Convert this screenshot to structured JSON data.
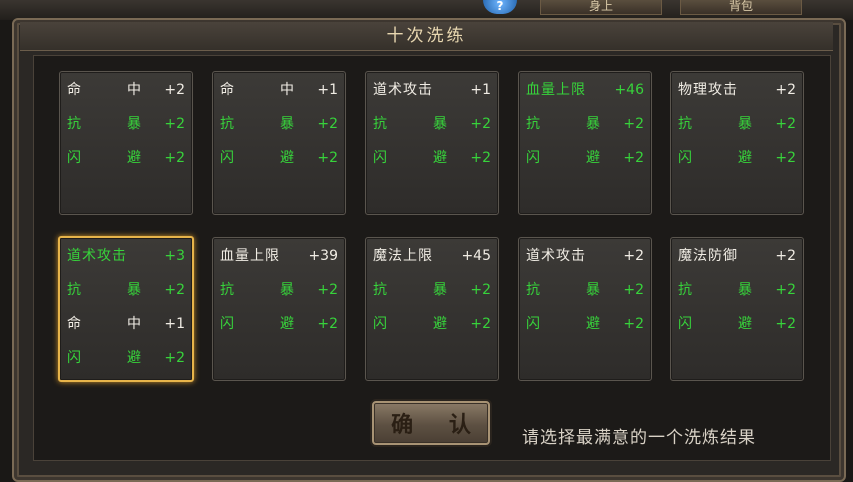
{
  "background": {
    "tabs": [
      "身上",
      "背包"
    ],
    "help_icon": "question-mark-icon"
  },
  "dialog": {
    "title": "十次洗练",
    "confirm_label": "确 认",
    "hint": "请选择最满意的一个洗炼结果",
    "accent_colors": {
      "green": "#37d33b",
      "white": "#f0ece4",
      "selected_border": "#e7b44a"
    }
  },
  "cards": [
    {
      "rows": [
        {
          "c1": "命",
          "c2": "中",
          "val": "+2",
          "color": "white"
        },
        {
          "c1": "抗",
          "c2": "暴",
          "val": "+2",
          "color": "green"
        },
        {
          "c1": "闪",
          "c2": "避",
          "val": "+2",
          "color": "green"
        }
      ]
    },
    {
      "rows": [
        {
          "c1": "命",
          "c2": "中",
          "val": "+1",
          "color": "white"
        },
        {
          "c1": "抗",
          "c2": "暴",
          "val": "+2",
          "color": "green"
        },
        {
          "c1": "闪",
          "c2": "避",
          "val": "+2",
          "color": "green"
        }
      ]
    },
    {
      "rows": [
        {
          "name": "道术攻击",
          "val": "+1",
          "color": "white"
        },
        {
          "c1": "抗",
          "c2": "暴",
          "val": "+2",
          "color": "green"
        },
        {
          "c1": "闪",
          "c2": "避",
          "val": "+2",
          "color": "green"
        }
      ]
    },
    {
      "rows": [
        {
          "name": "血量上限",
          "val": "+46",
          "color": "green"
        },
        {
          "c1": "抗",
          "c2": "暴",
          "val": "+2",
          "color": "green"
        },
        {
          "c1": "闪",
          "c2": "避",
          "val": "+2",
          "color": "green"
        }
      ]
    },
    {
      "rows": [
        {
          "name": "物理攻击",
          "val": "+2",
          "color": "white"
        },
        {
          "c1": "抗",
          "c2": "暴",
          "val": "+2",
          "color": "green"
        },
        {
          "c1": "闪",
          "c2": "避",
          "val": "+2",
          "color": "green"
        }
      ]
    },
    {
      "selected": true,
      "rows": [
        {
          "name": "道术攻击",
          "val": "+3",
          "color": "green"
        },
        {
          "c1": "抗",
          "c2": "暴",
          "val": "+2",
          "color": "green"
        },
        {
          "c1": "命",
          "c2": "中",
          "val": "+1",
          "color": "white"
        },
        {
          "c1": "闪",
          "c2": "避",
          "val": "+2",
          "color": "green"
        }
      ]
    },
    {
      "rows": [
        {
          "name": "血量上限",
          "val": "+39",
          "color": "white"
        },
        {
          "c1": "抗",
          "c2": "暴",
          "val": "+2",
          "color": "green"
        },
        {
          "c1": "闪",
          "c2": "避",
          "val": "+2",
          "color": "green"
        }
      ]
    },
    {
      "rows": [
        {
          "name": "魔法上限",
          "val": "+45",
          "color": "white"
        },
        {
          "c1": "抗",
          "c2": "暴",
          "val": "+2",
          "color": "green"
        },
        {
          "c1": "闪",
          "c2": "避",
          "val": "+2",
          "color": "green"
        }
      ]
    },
    {
      "rows": [
        {
          "name": "道术攻击",
          "val": "+2",
          "color": "white"
        },
        {
          "c1": "抗",
          "c2": "暴",
          "val": "+2",
          "color": "green"
        },
        {
          "c1": "闪",
          "c2": "避",
          "val": "+2",
          "color": "green"
        }
      ]
    },
    {
      "rows": [
        {
          "name": "魔法防御",
          "val": "+2",
          "color": "white"
        },
        {
          "c1": "抗",
          "c2": "暴",
          "val": "+2",
          "color": "green"
        },
        {
          "c1": "闪",
          "c2": "避",
          "val": "+2",
          "color": "green"
        }
      ]
    }
  ]
}
